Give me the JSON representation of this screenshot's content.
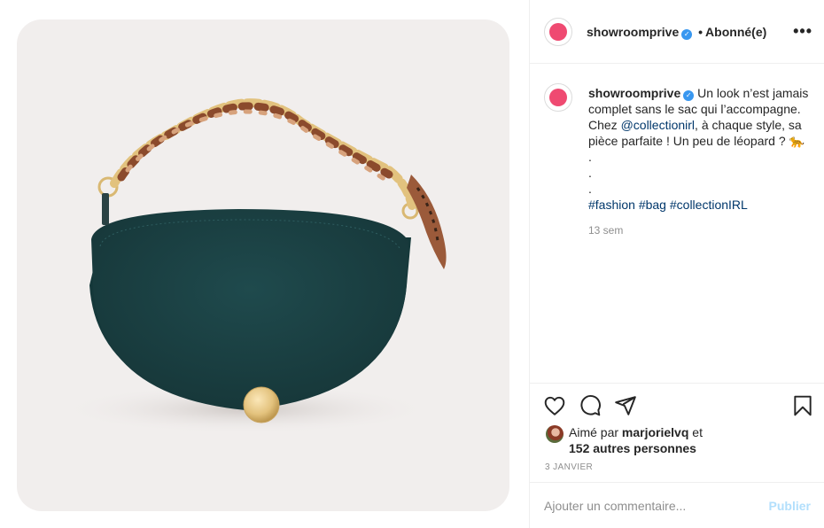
{
  "post": {
    "image_description": "",
    "accent_color": "#ef4a71",
    "verified_color": "#3897f0"
  },
  "header": {
    "username": "showroomprive",
    "separator": "•",
    "follow_status": "Abonné(e)",
    "more_icon": "more-options-icon"
  },
  "caption": {
    "username": "showroomprive",
    "text_part1": "Un look n’est jamais complet sans le sac qui l’accompagne. Chez ",
    "mention": "@collectionirl",
    "text_part2": ", à chaque style, sa pièce parfaite ! Un peu de léopard ? 🐆",
    "dot1": ".",
    "dot2": ".",
    "dot3": ".",
    "hashtag1": "#fashion",
    "hashtag2": "#bag",
    "hashtag3": "#collectionIRL",
    "time": "13 sem"
  },
  "actions": {
    "like_icon": "heart-icon",
    "comment_icon": "comment-icon",
    "share_icon": "send-icon",
    "save_icon": "bookmark-icon"
  },
  "likes": {
    "prefix": "Aimé par ",
    "user": "marjorielvq",
    "middle": " et",
    "others": "152 autres personnes"
  },
  "date": "3 JANVIER",
  "comment": {
    "placeholder": "Ajouter un commentaire...",
    "publish_label": "Publier"
  }
}
